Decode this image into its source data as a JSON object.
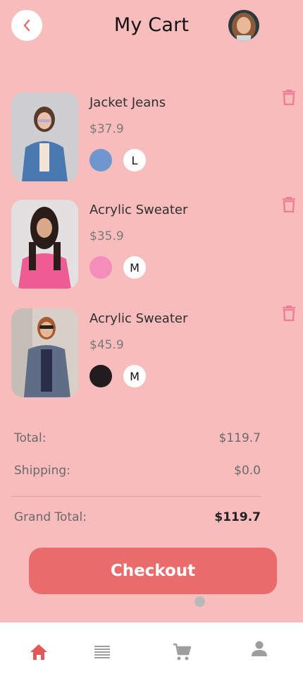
{
  "header": {
    "title": "My Cart",
    "back_icon": "chevron-left-icon",
    "avatar": "user-avatar"
  },
  "cart": {
    "items": [
      {
        "name": "Jacket Jeans",
        "price": "$37.9",
        "color": "#6f97cd",
        "size": "L"
      },
      {
        "name": "Acrylic Sweater",
        "price": "$35.9",
        "color": "#f48dbb",
        "size": "M"
      },
      {
        "name": "Acrylic Sweater",
        "price": "$45.9",
        "color": "#231c1e",
        "size": "M"
      }
    ]
  },
  "summary": {
    "total_label": "Total:",
    "total_value": "$119.7",
    "shipping_label": "Shipping:",
    "shipping_value": "$0.0",
    "grand_total_label": "Grand Total:",
    "grand_total_value": "$119.7"
  },
  "checkout_label": "Checkout",
  "nav": {
    "items": [
      {
        "name": "home",
        "icon": "home-icon",
        "active": true
      },
      {
        "name": "catalog",
        "icon": "list-icon",
        "active": false
      },
      {
        "name": "cart",
        "icon": "cart-icon",
        "active": false
      },
      {
        "name": "profile",
        "icon": "person-icon",
        "active": false
      }
    ]
  },
  "colors": {
    "background": "#f8bcbd",
    "accent": "#ea6b6b",
    "trash": "#ee7d95",
    "nav_inactive": "#9e9e9e"
  }
}
